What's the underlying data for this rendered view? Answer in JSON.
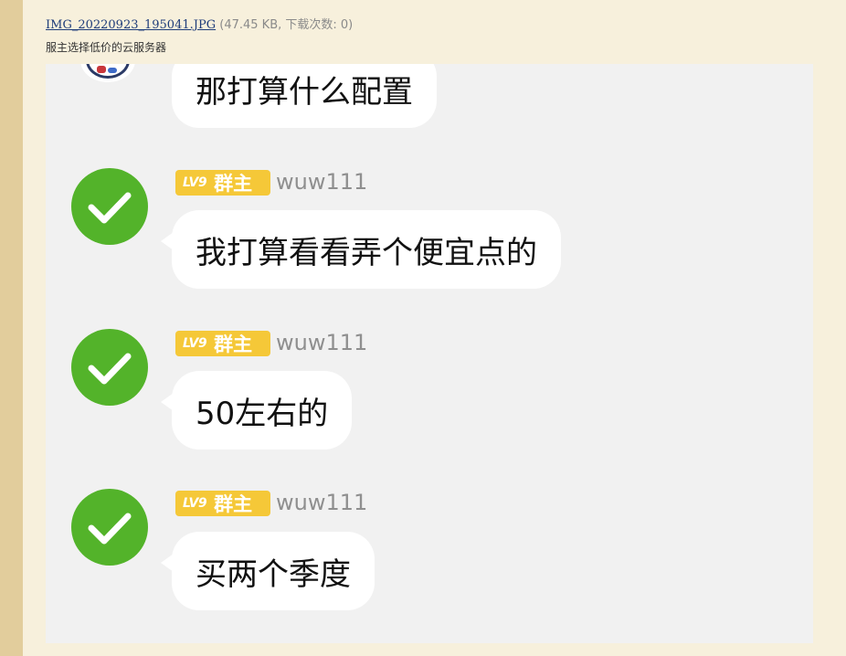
{
  "attachment": {
    "filename": "IMG_20220923_195041.JPG",
    "meta": "(47.45 KB, 下载次数: 0)",
    "description": "服主选择低价的云服务器"
  },
  "chat": {
    "first_message": "那打算什么配置",
    "messages": [
      {
        "level": "LV9",
        "role": "群主",
        "username": "wuw111",
        "text": "我打算看看弄个便宜点的"
      },
      {
        "level": "LV9",
        "role": "群主",
        "username": "wuw111",
        "text": "50左右的"
      },
      {
        "level": "LV9",
        "role": "群主",
        "username": "wuw111",
        "text": "买两个季度"
      }
    ]
  },
  "colors": {
    "page_bg": "#f7f0dc",
    "chat_bg": "#f1f1f1",
    "avatar_green": "#53b32a",
    "badge_yellow": "#f5c838",
    "link_blue": "#1f3d7a"
  },
  "icons": {
    "avatar": "checkmark-icon"
  }
}
